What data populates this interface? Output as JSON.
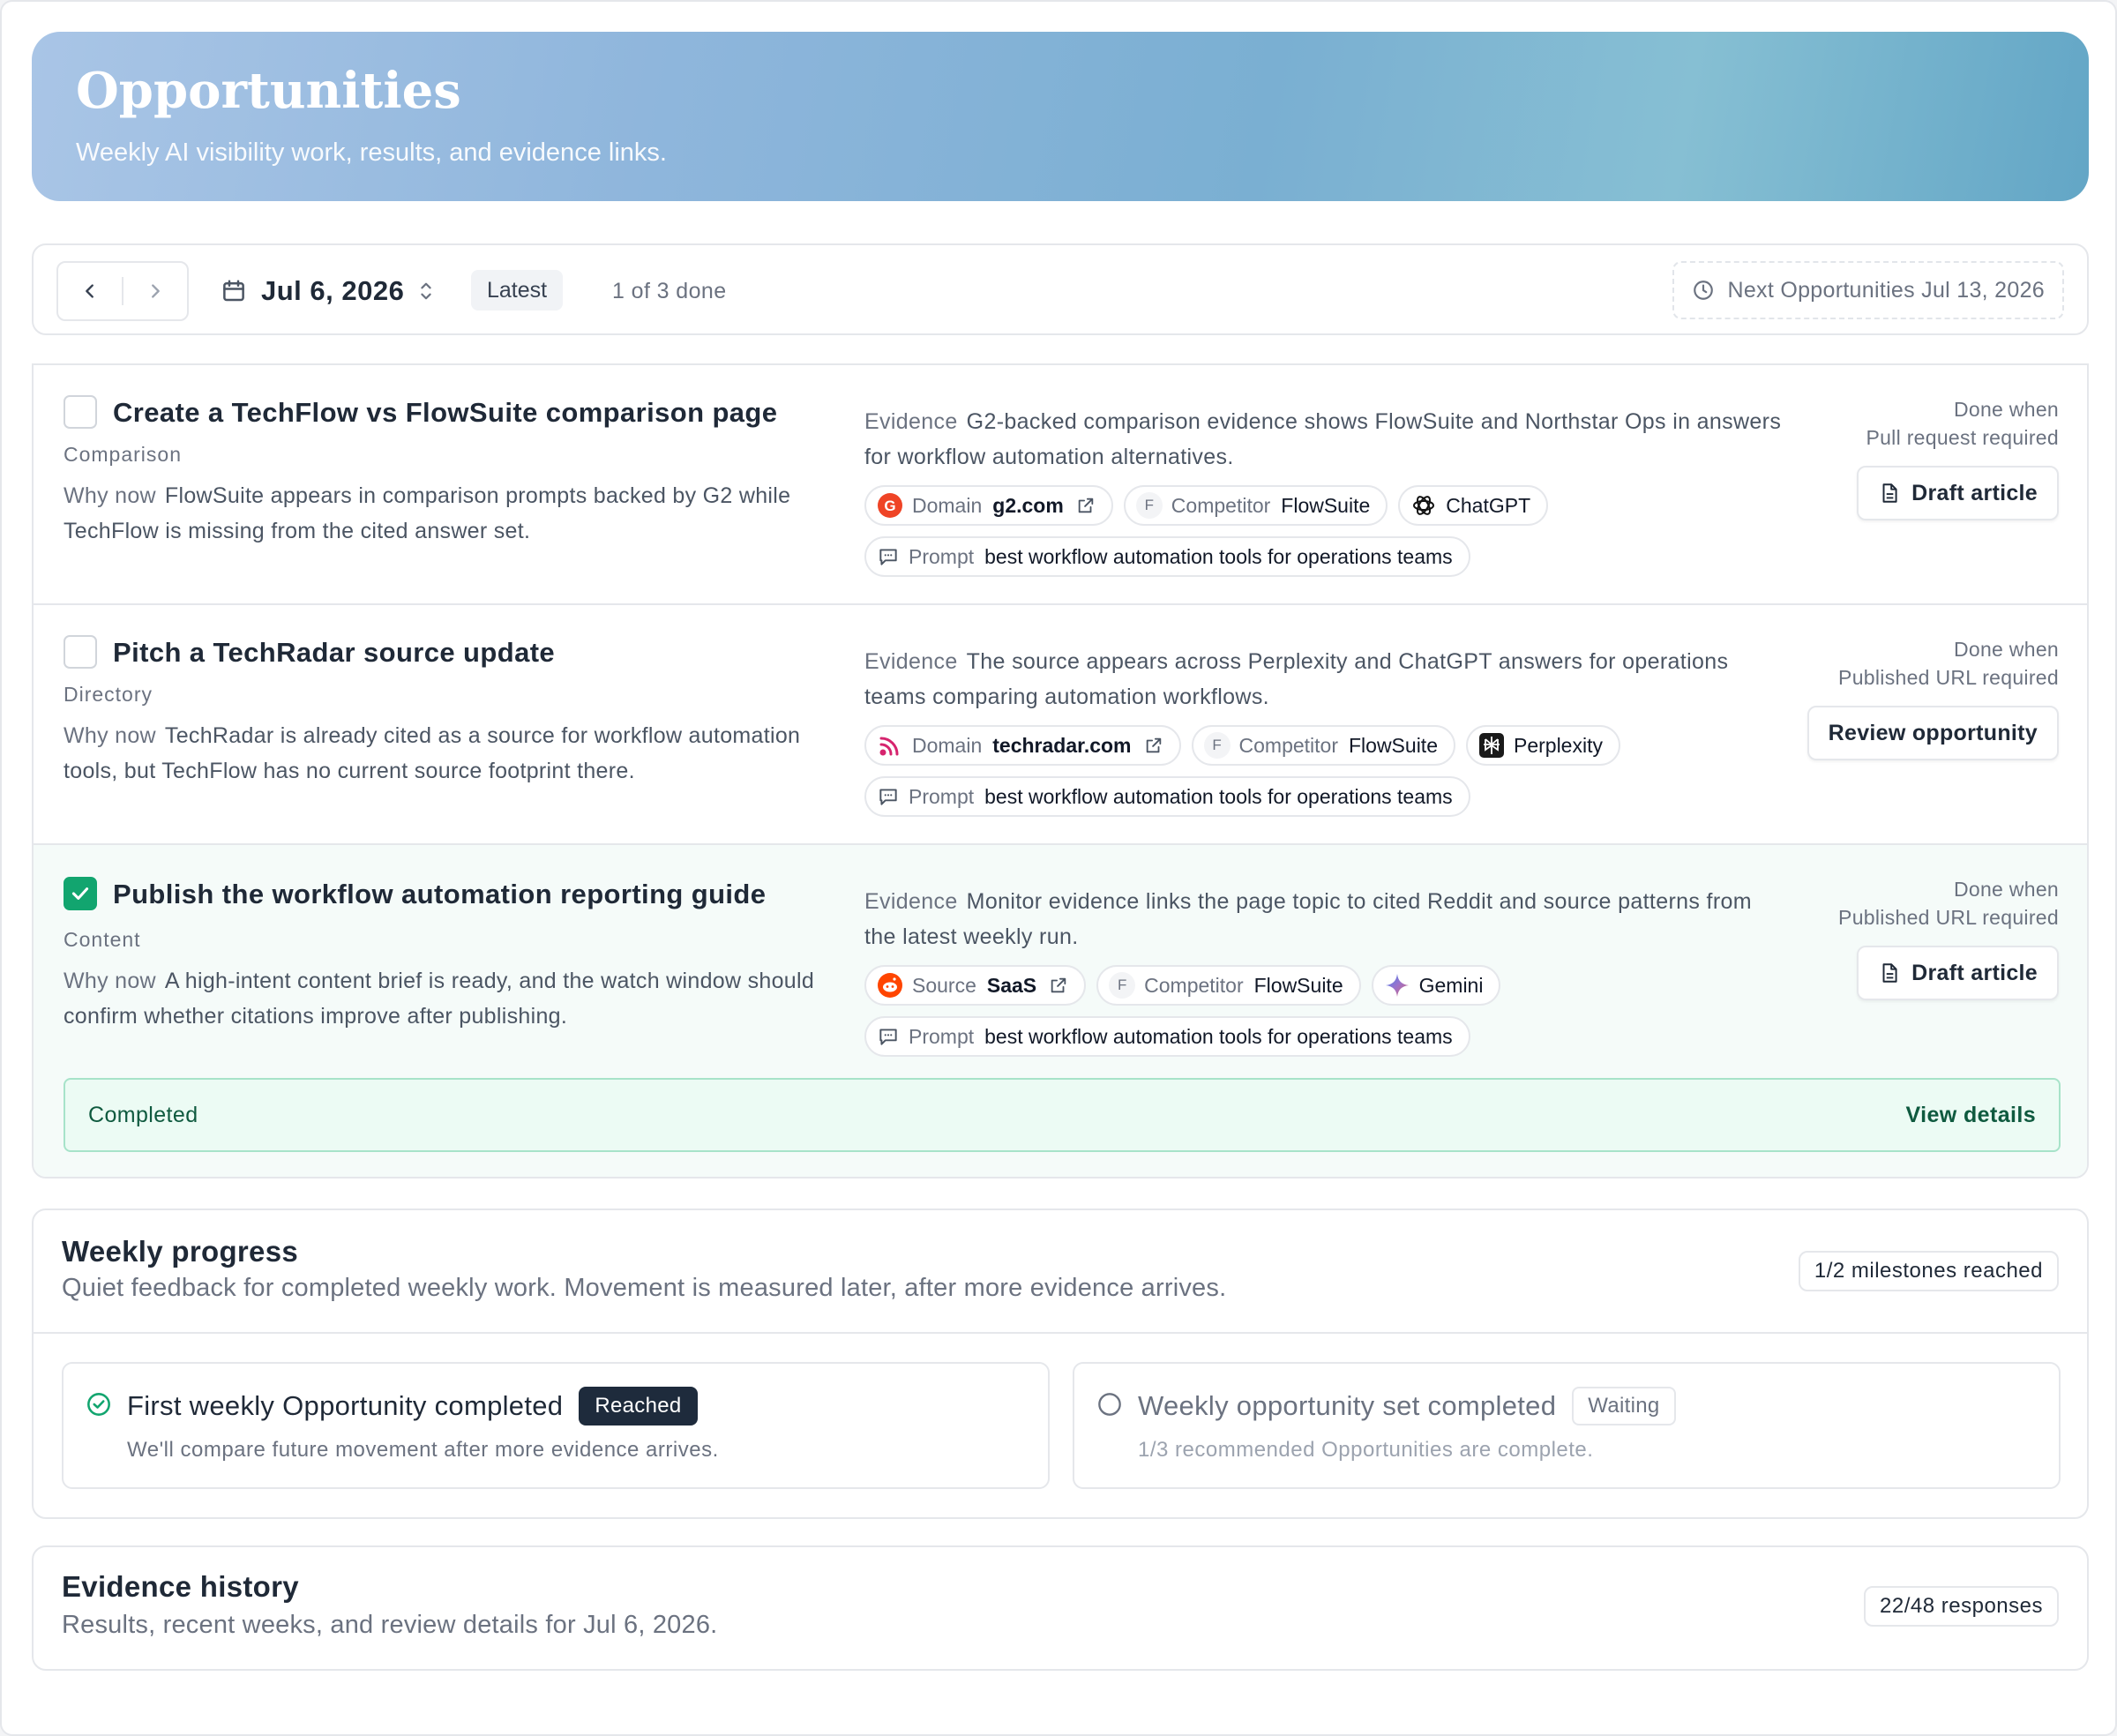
{
  "header": {
    "title": "Opportunities",
    "subtitle": "Weekly AI visibility work, results, and evidence links."
  },
  "toolbar": {
    "date": "Jul 6, 2026",
    "latest_badge": "Latest",
    "done_count": "1 of 3 done",
    "next": "Next Opportunities Jul 13, 2026"
  },
  "opportunities": [
    {
      "title": "Create a TechFlow vs FlowSuite comparison page",
      "category": "Comparison",
      "why_label": "Why now",
      "why_text": "FlowSuite appears in comparison prompts backed by G2 while TechFlow is missing from the cited answer set.",
      "evidence_label": "Evidence",
      "evidence_text": "G2-backed comparison evidence shows FlowSuite and Northstar Ops in answers for workflow automation alternatives.",
      "chip1_key": "Domain",
      "chip1_value": "g2.com",
      "chip2_key": "Competitor",
      "chip2_value": "FlowSuite",
      "chip2_letter": "F",
      "engine": "ChatGPT",
      "prompt_key": "Prompt",
      "prompt_value": "best workflow automation tools for operations teams",
      "done_when": "Done when",
      "requirement": "Pull request required",
      "action": "Draft article",
      "checked": false
    },
    {
      "title": "Pitch a TechRadar source update",
      "category": "Directory",
      "why_label": "Why now",
      "why_text": "TechRadar is already cited as a source for workflow automation tools, but TechFlow has no current source footprint there.",
      "evidence_label": "Evidence",
      "evidence_text": "The source appears across Perplexity and ChatGPT answers for operations teams comparing automation workflows.",
      "chip1_key": "Domain",
      "chip1_value": "techradar.com",
      "chip2_key": "Competitor",
      "chip2_value": "FlowSuite",
      "chip2_letter": "F",
      "engine": "Perplexity",
      "prompt_key": "Prompt",
      "prompt_value": "best workflow automation tools for operations teams",
      "done_when": "Done when",
      "requirement": "Published URL required",
      "action": "Review opportunity",
      "checked": false
    },
    {
      "title": "Publish the workflow automation reporting guide",
      "category": "Content",
      "why_label": "Why now",
      "why_text": "A high-intent content brief is ready, and the watch window should confirm whether citations improve after publishing.",
      "evidence_label": "Evidence",
      "evidence_text": "Monitor evidence links the page topic to cited Reddit and source patterns from the latest weekly run.",
      "chip1_key": "Source",
      "chip1_value": "SaaS",
      "chip2_key": "Competitor",
      "chip2_value": "FlowSuite",
      "chip2_letter": "F",
      "engine": "Gemini",
      "prompt_key": "Prompt",
      "prompt_value": "best workflow automation tools for operations teams",
      "done_when": "Done when",
      "requirement": "Published URL required",
      "action": "Draft article",
      "checked": true,
      "completed_label": "Completed",
      "view_details": "View details"
    }
  ],
  "progress": {
    "title": "Weekly progress",
    "subtitle": "Quiet feedback for completed weekly work. Movement is measured later, after more evidence arrives.",
    "milestones_pill": "1/2 milestones reached",
    "milestones": [
      {
        "title": "First weekly Opportunity completed",
        "status": "Reached",
        "desc": "We'll compare future movement after more evidence arrives."
      },
      {
        "title": "Weekly opportunity set completed",
        "status": "Waiting",
        "desc": "1/3 recommended Opportunities are complete."
      }
    ]
  },
  "evidence_history": {
    "title": "Evidence history",
    "subtitle": "Results, recent weeks, and review details for Jul 6, 2026.",
    "responses": "22/48 responses"
  },
  "colors": {
    "accent_green": "#12a56f",
    "dark_badge": "#1e2b3c",
    "hero_gradient_start": "#a9c5e6",
    "hero_gradient_end": "#63a6c6"
  }
}
